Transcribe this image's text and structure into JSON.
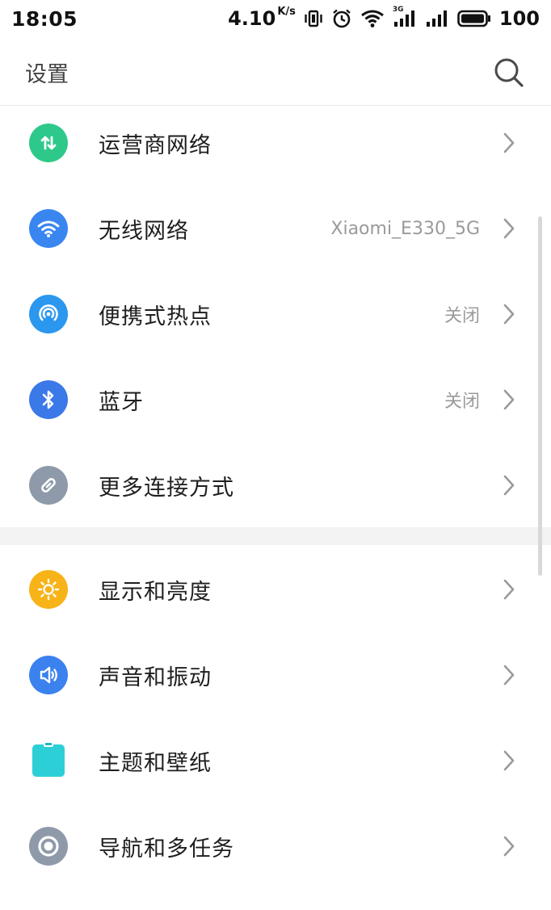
{
  "status_bar": {
    "time": "18:05",
    "net_speed": "4.10",
    "net_speed_unit": "K/s",
    "network_type": "3G",
    "battery_level": "100"
  },
  "header": {
    "title": "设置",
    "search_icon": "search-icon"
  },
  "sections": [
    {
      "items": [
        {
          "label": "运营商网络",
          "value": "",
          "icon": "mobile-data-icon",
          "icon_color": "#2ec98a"
        },
        {
          "label": "无线网络",
          "value": "Xiaomi_E330_5G",
          "icon": "wifi-icon",
          "icon_color": "#3a86f0"
        },
        {
          "label": "便携式热点",
          "value": "关闭",
          "icon": "hotspot-icon",
          "icon_color": "#2b97ee"
        },
        {
          "label": "蓝牙",
          "value": "关闭",
          "icon": "bluetooth-icon",
          "icon_color": "#3b78e8"
        },
        {
          "label": "更多连接方式",
          "value": "",
          "icon": "link-icon",
          "icon_color": "#8e9aaa"
        }
      ]
    },
    {
      "items": [
        {
          "label": "显示和亮度",
          "value": "",
          "icon": "brightness-icon",
          "icon_color": "#f7b318"
        },
        {
          "label": "声音和振动",
          "value": "",
          "icon": "sound-icon",
          "icon_color": "#3b82ee"
        },
        {
          "label": "主题和壁纸",
          "value": "",
          "icon": "theme-icon",
          "icon_color": "#2ccfd6"
        },
        {
          "label": "导航和多任务",
          "value": "",
          "icon": "navigation-icon",
          "icon_color": "#8e9aaa"
        }
      ]
    }
  ]
}
